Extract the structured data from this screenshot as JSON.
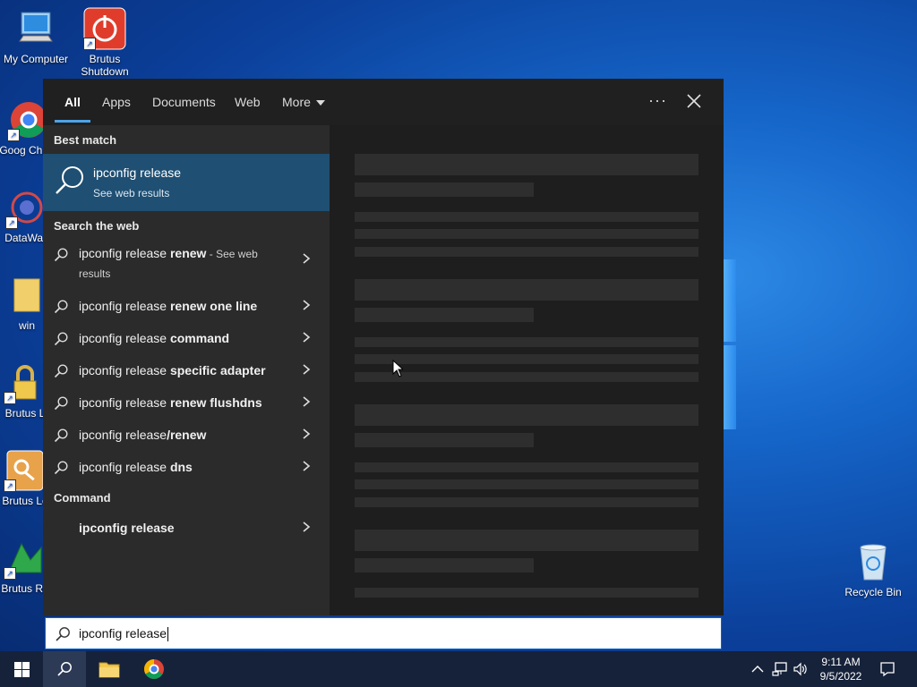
{
  "desktop_icons": [
    {
      "label": "My Computer",
      "icon": "computer-icon"
    },
    {
      "label": "Brutus Shutdown",
      "icon": "power-icon"
    },
    {
      "label": "Goog Chron",
      "icon": "chrome-icon"
    },
    {
      "label": "DataWag",
      "icon": "app-icon"
    },
    {
      "label": "win",
      "icon": "folder-icon"
    },
    {
      "label": "Brutus L",
      "icon": "lock-icon"
    },
    {
      "label": "Brutus Lo",
      "icon": "key-icon"
    },
    {
      "label": "Brutus Re",
      "icon": "app-icon"
    },
    {
      "label": "Recycle Bin",
      "icon": "recycle-bin-icon"
    }
  ],
  "search": {
    "tabs": [
      "All",
      "Apps",
      "Documents",
      "Web",
      "More"
    ],
    "active_tab": "All",
    "more_options": "···",
    "best_match": {
      "section": "Best match",
      "title": "ipconfig release",
      "subtitle": "See web results"
    },
    "web": {
      "section": "Search the web",
      "items": [
        {
          "prefix": "ipconfig release ",
          "bold": "renew",
          "suffix": " - See web",
          "suffix2": "results"
        },
        {
          "prefix": "ipconfig release ",
          "bold": "renew one line"
        },
        {
          "prefix": "ipconfig release ",
          "bold": "command"
        },
        {
          "prefix": "ipconfig release ",
          "bold": "specific adapter"
        },
        {
          "prefix": "ipconfig release ",
          "bold": "renew flushdns"
        },
        {
          "prefix": "ipconfig release",
          "bold": "/renew"
        },
        {
          "prefix": "ipconfig release ",
          "bold": "dns"
        }
      ]
    },
    "command": {
      "section": "Command",
      "item": "ipconfig release"
    },
    "query": "ipconfig release"
  },
  "taskbar": {
    "pinned": [
      "start-button",
      "search-button",
      "file-explorer",
      "chrome"
    ],
    "time": "9:11 AM",
    "date": "9/5/2022"
  },
  "colors": {
    "accent": "#4ea3e8",
    "best_match_bg": "#1f4f72",
    "panel_bg": "#2b2b2b"
  }
}
